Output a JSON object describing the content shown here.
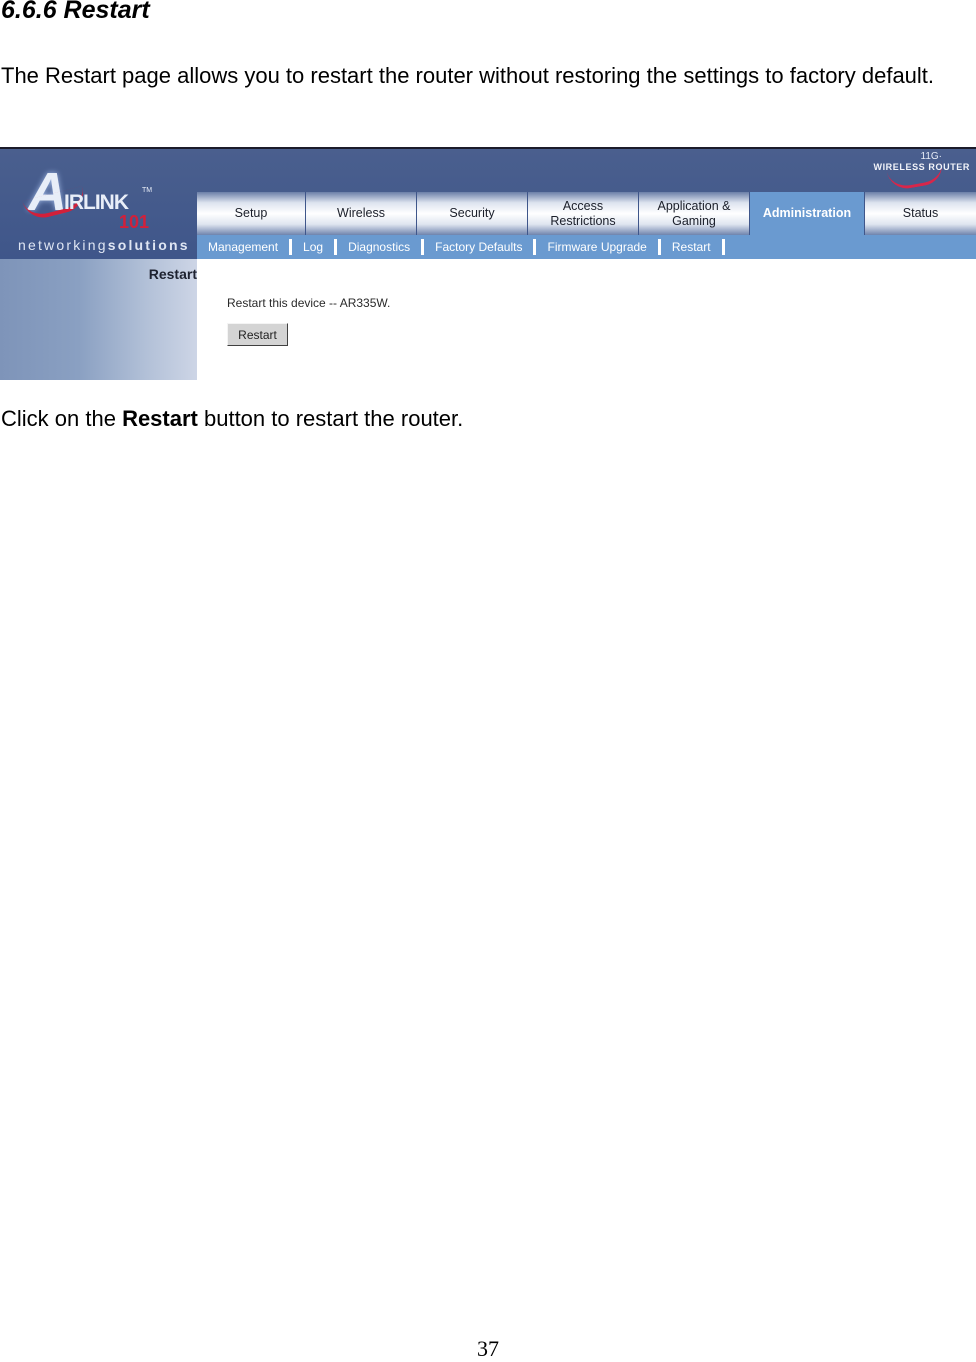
{
  "document": {
    "section_title": "6.6.6 Restart",
    "intro": "The Restart page allows you to restart the router without restoring the settings to factory default.",
    "caption": {
      "prefix": "Click on the ",
      "bold": "Restart",
      "suffix": " button to restart the router."
    },
    "page_number": "37"
  },
  "router_ui": {
    "logo": {
      "letter": "A",
      "wordmark": "IRLINK",
      "tm": "TM",
      "number": "101",
      "tagline_light": "networking",
      "tagline_bold": "solutions"
    },
    "badge": {
      "top": "11G·",
      "text": "WIRELESS ROUTER"
    },
    "tabs": [
      {
        "label": "Setup",
        "active": false
      },
      {
        "label": "Wireless",
        "active": false
      },
      {
        "label": "Security",
        "active": false
      },
      {
        "label": "Access Restrictions",
        "active": false
      },
      {
        "label": "Application & Gaming",
        "active": false
      },
      {
        "label": "Administration",
        "active": true
      },
      {
        "label": "Status",
        "active": false
      }
    ],
    "subnav": [
      {
        "label": "Management"
      },
      {
        "label": "Log"
      },
      {
        "label": "Diagnostics"
      },
      {
        "label": "Factory Defaults"
      },
      {
        "label": "Firmware Upgrade"
      },
      {
        "label": "Restart"
      }
    ],
    "sidebar_title": "Restart",
    "description": "Restart this device -- AR335W.",
    "restart_button": "Restart",
    "colors": {
      "header_bg": "#4a5f8e",
      "subnav_bg": "#6a9ad0",
      "active_tab_bg": "#6a9ad0",
      "brand_red": "#d2203a"
    }
  }
}
